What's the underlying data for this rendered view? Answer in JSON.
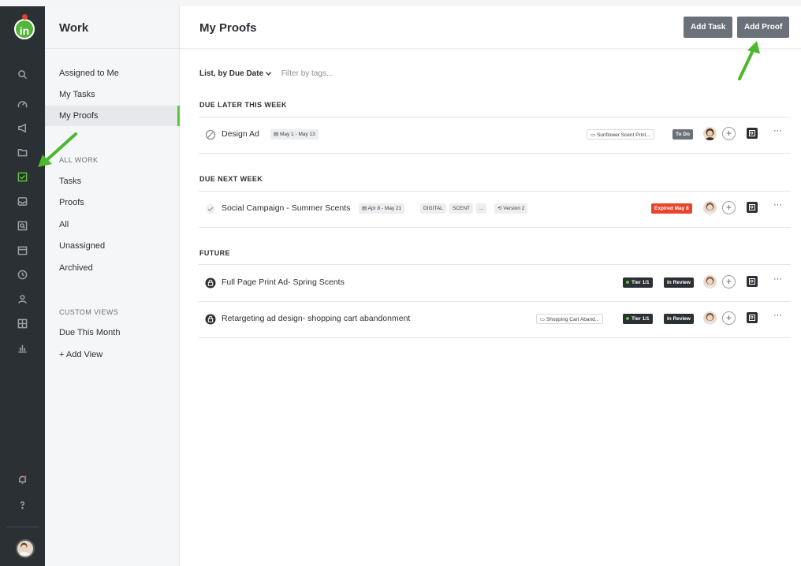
{
  "app": {
    "logo": "in"
  },
  "rail_icons": [
    "search-icon",
    "gauge-icon",
    "megaphone-icon",
    "folder-icon",
    "checkbox-icon",
    "inbox-icon",
    "proof-icon",
    "calendar-icon",
    "clock-icon",
    "person-icon",
    "grid-icon",
    "bar-chart-icon",
    "notification-bell-icon",
    "help-icon"
  ],
  "nav": {
    "title": "Work",
    "items_top": [
      "Assigned to Me",
      "My Tasks",
      "My Proofs"
    ],
    "section_all": "ALL WORK",
    "items_all": [
      "Tasks",
      "Proofs",
      "All",
      "Unassigned",
      "Archived"
    ],
    "section_custom": "CUSTOM VIEWS",
    "items_custom": [
      "Due This Month"
    ],
    "add_view": "+ Add View"
  },
  "main": {
    "title": "My Proofs",
    "add_task": "Add Task",
    "add_proof": "Add Proof",
    "sort_label": "List, by Due Date",
    "filter_placeholder": "Filter by tags...",
    "groups": [
      "DUE LATER THIS WEEK",
      "DUE NEXT WEEK",
      "FUTURE"
    ]
  },
  "rows": [
    {
      "name": "Design Ad",
      "date": "May 1 - May 13",
      "project": "Sunflower Scent Print...",
      "status": "To Do"
    },
    {
      "name": "Social Campaign - Summer Scents",
      "date": "Apr 8 - May 21",
      "tags": [
        "DIGITAL",
        "SCENT",
        "..."
      ],
      "version": "Version 2",
      "status": "Expired May 8"
    },
    {
      "name": "Full Page Print Ad- Spring Scents",
      "tier": "Tier 1/1",
      "status": "In Review"
    },
    {
      "name": "Retargeting ad design- shopping cart abandonment",
      "project": "Shopping Cart Aband...",
      "tier": "Tier 1/1",
      "status": "In Review"
    }
  ],
  "more_label": "···",
  "colors": {
    "accent": "#5ac43a",
    "rail": "#2b3035",
    "expired": "#e8452c",
    "button": "#6b7178"
  }
}
